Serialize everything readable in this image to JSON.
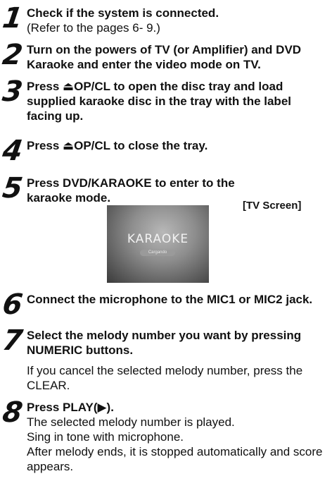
{
  "steps": [
    {
      "num": "1",
      "bold": "Check if the system is connected.",
      "regular": "(Refer to the pages 6- 9.)"
    },
    {
      "num": "2",
      "bold": "Turn on the powers of TV (or Amplifier) and DVD Karaoke and enter the video mode on TV."
    },
    {
      "num": "3",
      "bold": "Press ⏏OP/CL to open the disc tray and load supplied karaoke disc in the tray with the label facing up."
    },
    {
      "num": "4",
      "bold": "Press ⏏OP/CL to close the tray."
    },
    {
      "num": "5",
      "bold": "Press DVD/KARAOKE to enter to the karaoke mode."
    },
    {
      "num": "6",
      "bold": "Connect the microphone to the MIC1 or MIC2 jack."
    },
    {
      "num": "7",
      "bold": "Select the melody number you want by pressing NUMERIC buttons.",
      "regular": "If you cancel the selected melody number, press the CLEAR."
    },
    {
      "num": "8",
      "bold": "Press PLAY(▶).",
      "regular_lines": [
        "The selected melody number is played.",
        "Sing in tone with microphone.",
        "After melody ends, it is stopped automatically and score appears."
      ]
    }
  ],
  "tv_screen": {
    "label": "[TV Screen]",
    "title": "KARAOKE",
    "pill": "Cargando"
  }
}
